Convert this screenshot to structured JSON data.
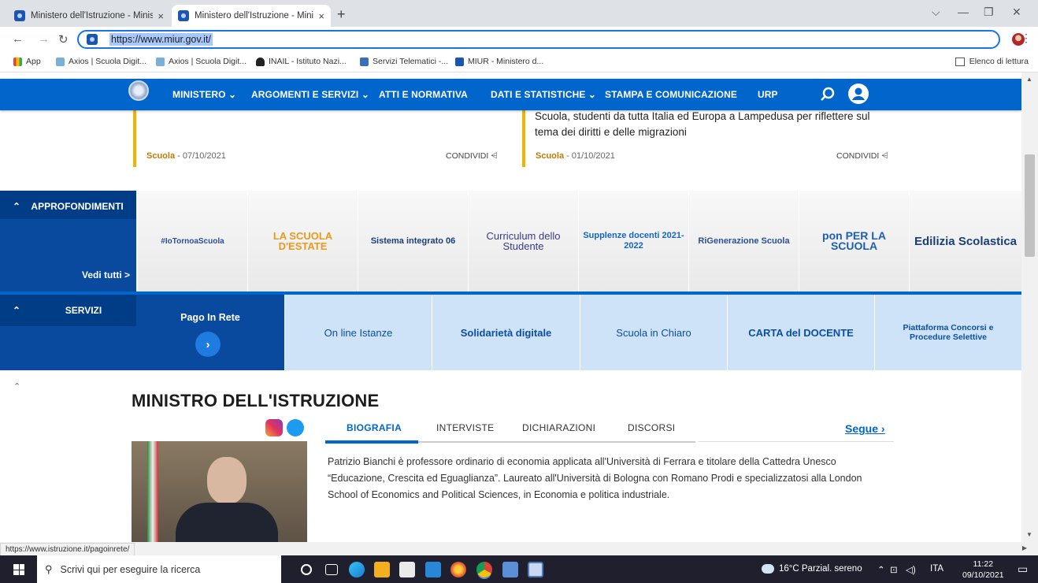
{
  "browser": {
    "tabs": [
      {
        "title": "Ministero dell'Istruzione - Minist",
        "close": "×"
      },
      {
        "title": "Ministero dell'Istruzione - Minist",
        "close": "×"
      }
    ],
    "new_tab": "+",
    "url": "https://www.miur.gov.it/",
    "bookmarks": [
      {
        "label": "App"
      },
      {
        "label": "Axios | Scuola Digit..."
      },
      {
        "label": "Axios | Scuola Digit..."
      },
      {
        "label": "INAIL - Istituto Nazi..."
      },
      {
        "label": "Servizi Telematici -..."
      },
      {
        "label": "MIUR - Ministero d..."
      }
    ],
    "reading_list": "Elenco di lettura",
    "status_url": "https://www.istruzione.it/pagoinrete/"
  },
  "nav": {
    "items": [
      "MINISTERO",
      "ARGOMENTI E SERVIZI",
      "ATTI E NORMATIVA",
      "DATI E STATISTICHE",
      "STAMPA E COMUNICAZIONE",
      "URP"
    ]
  },
  "news": [
    {
      "headline": "",
      "category": "Scuola",
      "date": " - 07/10/2021",
      "share": "CONDIVIDI"
    },
    {
      "headline": "Scuola, studenti da tutta Italia ed Europa a Lampedusa per riflettere sul tema dei diritti e delle migrazioni",
      "category": "Scuola",
      "date": " - 01/10/2021",
      "share": "CONDIVIDI"
    }
  ],
  "approfondimenti": {
    "title": "APPROFONDIMENTI",
    "see_all": "Vedi tutti >",
    "tiles": [
      {
        "label": "#IoTornoaScuola"
      },
      {
        "label": "LA SCUOLA D'ESTATE"
      },
      {
        "label": "Sistema integrato 06"
      },
      {
        "label": "Curriculum dello Studente"
      },
      {
        "label": "Supplenze docenti 2021-2022"
      },
      {
        "label": "RiGenerazione Scuola"
      },
      {
        "label": "pon PER LA SCUOLA"
      },
      {
        "label": "Edilizia Scolastica"
      }
    ]
  },
  "servizi": {
    "title": "SERVIZI",
    "pago": "Pago In Rete",
    "tiles": [
      {
        "label": "On line Istanze"
      },
      {
        "label": "Solidarietà digitale"
      },
      {
        "label": "Scuola in Chiaro"
      },
      {
        "label": "CARTA del DOCENTE"
      },
      {
        "label": "Piattaforma Concorsi e Procedure Selettive"
      }
    ]
  },
  "minister": {
    "title": "MINISTRO DELL'ISTRUZIONE",
    "tabs": [
      "BIOGRAFIA",
      "INTERVISTE",
      "DICHIARAZIONI",
      "DISCORSI"
    ],
    "follow": "Segue ›",
    "bio": "Patrizio Bianchi è professore ordinario di economia applicata all'Università di Ferrara e titolare della Cattedra Unesco “Educazione, Crescita ed Eguaglianza”. Laureato all'Università di Bologna con Romano Prodi e specializzatosi alla London School of Economics and Political Sciences, in Economia e politica industriale."
  },
  "taskbar": {
    "search_placeholder": "Scrivi qui per eseguire la ricerca",
    "weather": "16°C Parzial. sereno",
    "lang": "ITA",
    "time": "11:22",
    "date": "09/10/2021"
  },
  "colors": {
    "nav_blue": "#0066cc",
    "dark_blue": "#0a4a9e",
    "accent_yellow": "#f0b400"
  }
}
